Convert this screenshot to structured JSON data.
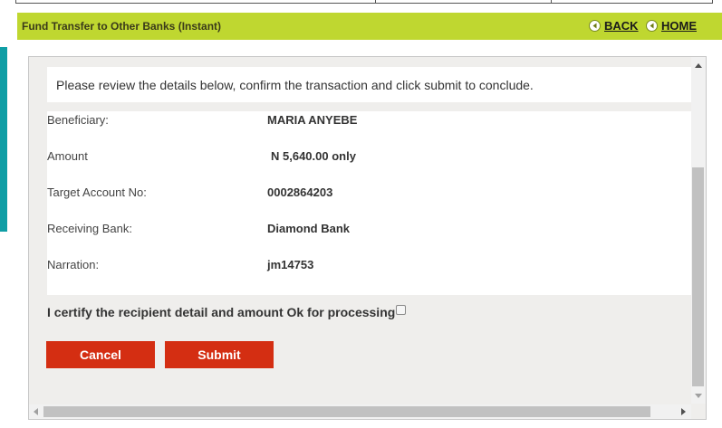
{
  "header": {
    "title": "Fund Transfer to Other Banks (Instant)",
    "back_label": "BACK",
    "home_label": "HOME",
    "back_icon": "back-arrow-icon",
    "home_icon": "home-arrow-icon"
  },
  "intro": {
    "text": "Please review the details below, confirm the transaction and click submit to conclude."
  },
  "details": {
    "beneficiary_label": "Beneficiary:",
    "beneficiary_value": "MARIA ANYEBE",
    "amount_label": "Amount",
    "amount_value": "N 5,640.00 only",
    "account_label": "Target Account No:",
    "account_value": "0002864203",
    "bank_label": "Receiving Bank:",
    "bank_value": "Diamond Bank",
    "narration_label": "Narration:",
    "narration_value": "jm14753"
  },
  "certify": {
    "label": "I certify the recipient detail and amount Ok for processing",
    "checked": false
  },
  "buttons": {
    "cancel_label": "Cancel",
    "submit_label": "Submit"
  },
  "colors": {
    "header_bg": "#bfd730",
    "accent_teal": "#0f9ea5",
    "button_red": "#d42e12"
  }
}
